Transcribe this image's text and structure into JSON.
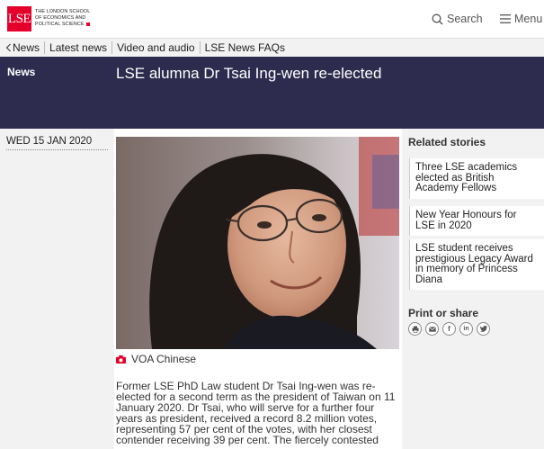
{
  "header": {
    "logo_mark": "LSE",
    "logo_lines": [
      "The London School",
      "of Economics and",
      "Political Science"
    ],
    "search_label": "Search",
    "menu_label": "Menu"
  },
  "subnav": {
    "items": [
      "News",
      "Latest news",
      "Video and audio",
      "LSE News FAQs"
    ]
  },
  "banner": {
    "section": "News",
    "title": "LSE alumna Dr Tsai Ing-wen re-elected"
  },
  "article": {
    "date": "WED 15 JAN 2020",
    "image_credit": "VOA Chinese",
    "body": "Former LSE PhD Law student Dr Tsai Ing-wen was re-elected for a second term as the president of Taiwan on 11 January 2020. Dr Tsai, who will serve for a further four years as president, received a record 8.2 million votes, representing 57 per cent of the votes, with her closest contender receiving 39 per cent. The fiercely contested"
  },
  "related": {
    "title": "Related stories",
    "stories": [
      "Three LSE academics elected as British Academy Fellows",
      "New Year Honours for LSE in 2020",
      "LSE student receives prestigious Legacy Award in memory of Princess Diana"
    ]
  },
  "share": {
    "title": "Print or share",
    "icons": [
      "print-icon",
      "email-icon",
      "facebook-icon",
      "linkedin-icon",
      "twitter-icon"
    ]
  },
  "colors": {
    "brand_red": "#e4002b",
    "banner_navy": "#2e2c4e",
    "panel_grey": "#f2f2f2"
  }
}
